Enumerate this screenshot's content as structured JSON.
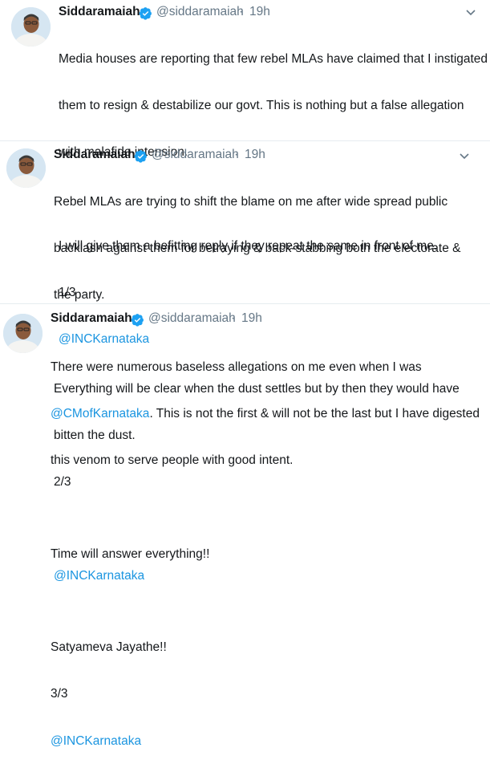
{
  "accent_color": "#1b95e0",
  "verified_color": "#1da1f2",
  "tweets": [
    {
      "name": "Siddaramaiah",
      "handle": "@siddaramaiah",
      "separator": "·",
      "time": "19h",
      "lines": [
        "Media houses are reporting that few rebel MLAs have claimed that I instigated",
        "them to resign & destabilize our govt. This is nothing but a false allegation",
        "with malafide intension.",
        "",
        "I will give them a befitting reply if they repeat the same in front of me.",
        "1/3"
      ],
      "mention": "@INCKarnataka"
    },
    {
      "name": "Siddaramaiah",
      "handle": "@siddaramaiah",
      "separator": "·",
      "time": "19h",
      "lines": [
        "Rebel MLAs are trying to shift the blame on me after wide spread public",
        "backlash against them for betraying & back-stabbing both the electorate &",
        "the party.",
        "",
        "Everything will be clear when the dust settles but by then they would have",
        "bitten the dust.",
        "2/3",
        ""
      ],
      "mention": "@INCKarnataka"
    },
    {
      "name": "Siddaramaiah",
      "handle": "@siddaramaiah",
      "separator": "·",
      "time": "19h",
      "line1": "There were numerous baseless allegations on me even when I was",
      "inline_mention": "@CMofKarnataka",
      "line2_rest": ". This is not the first & will not be the last but I have digested",
      "lines": [
        "this venom to serve people with good intent.",
        "",
        "Time will answer everything!!",
        "",
        "Satyameva Jayathe!!",
        "3/3"
      ],
      "mention": "@INCKarnataka"
    }
  ]
}
